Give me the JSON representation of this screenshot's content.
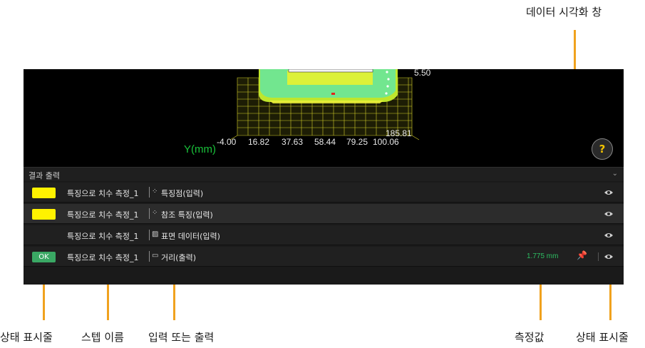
{
  "callouts": {
    "viewer": "데이터 시각화 창",
    "status_left": "상태 표시줄",
    "step_name": "스텝 이름",
    "io": "입력 또는 출력",
    "measured": "측정값",
    "status_right": "상태 표시줄"
  },
  "viewer": {
    "axis_title": "Y(mm)",
    "ticks": [
      "-4.00",
      "16.82",
      "37.63",
      "58.44",
      "79.25",
      "100.06"
    ],
    "top_value": "5.50",
    "side_value": "185.81",
    "help": "?"
  },
  "panel": {
    "title": "결과 출력",
    "rows": [
      {
        "status": "",
        "step": "특징으로 치수 측정_1",
        "io_icon": "⁘",
        "io": "특징점(입력)",
        "value": "",
        "pin": false
      },
      {
        "status": "",
        "step": "특징으로 치수 측정_1",
        "io_icon": "⁘",
        "io": "참조 특징(입력)",
        "value": "",
        "pin": false
      },
      {
        "status": "",
        "step": "특징으로 치수 측정_1",
        "io_icon": "▨",
        "io": "표면 데이터(입력)",
        "value": "",
        "pin": false
      },
      {
        "status": "OK",
        "step": "특징으로 치수 측정_1",
        "io_icon": "▭",
        "io": "거리(출력)",
        "value": "1.775 mm",
        "pin": true
      }
    ]
  },
  "colors": {
    "status_yellow": "#fff200",
    "status_ok": "#3aa864",
    "value_green": "#2dbd62",
    "leader": "#f0a21e",
    "axis_green": "#19c23a"
  }
}
